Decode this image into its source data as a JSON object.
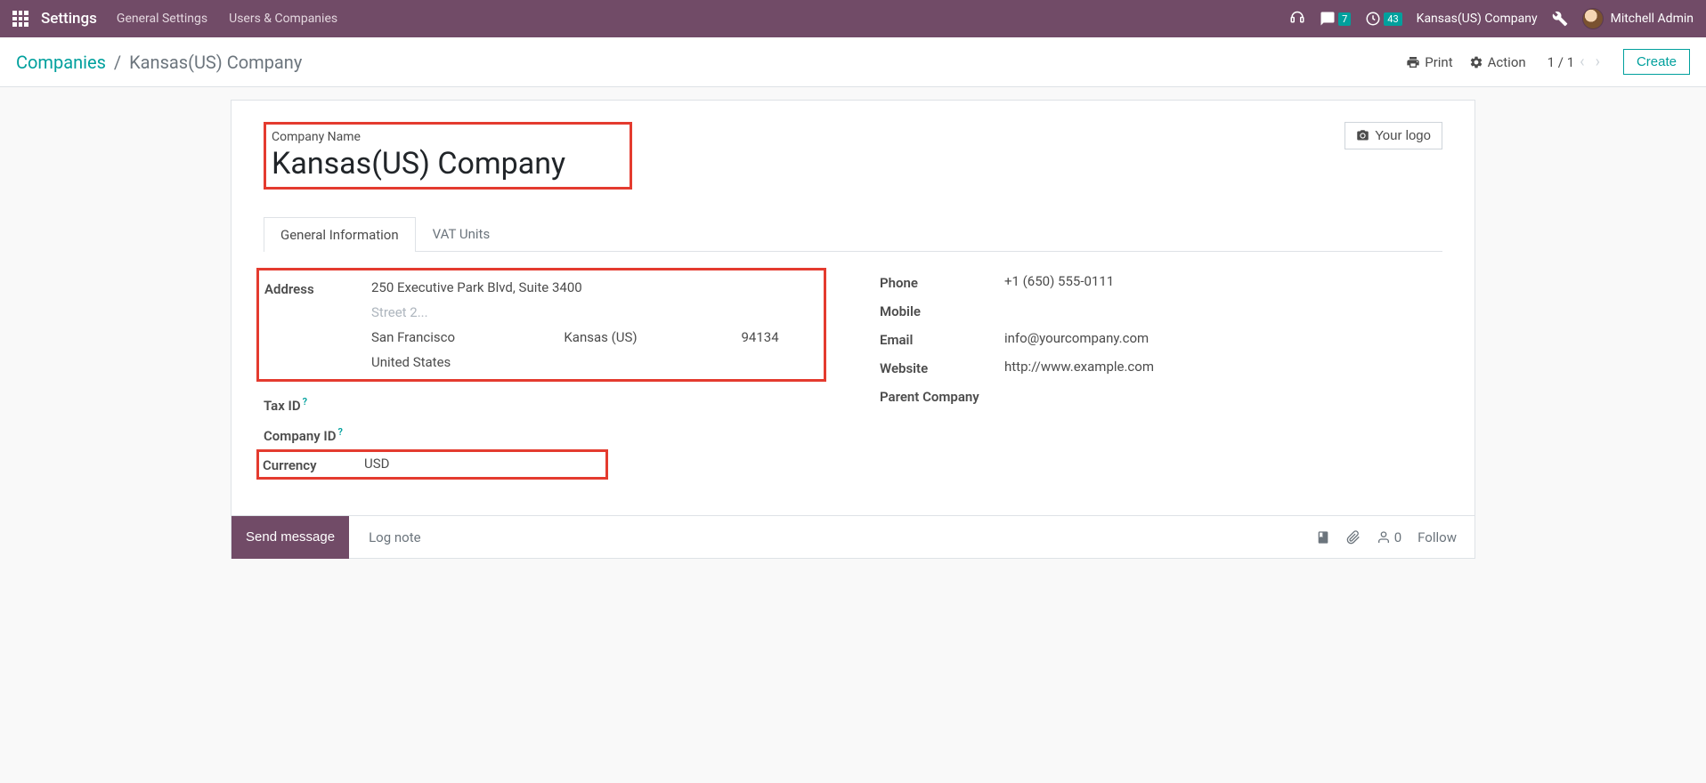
{
  "topnav": {
    "brand": "Settings",
    "menu": [
      "General Settings",
      "Users & Companies"
    ],
    "msg_badge": "7",
    "activity_badge": "43",
    "company": "Kansas(US) Company",
    "user": "Mitchell Admin"
  },
  "ctrlbar": {
    "bc_root": "Companies",
    "bc_current": "Kansas(US) Company",
    "print": "Print",
    "action": "Action",
    "pager": "1 / 1",
    "create": "Create"
  },
  "sheet": {
    "logo_label": "Your logo",
    "name_label": "Company Name",
    "name_value": "Kansas(US) Company",
    "tabs": {
      "general": "General Information",
      "vat": "VAT Units"
    },
    "labels": {
      "address": "Address",
      "tax_id": "Tax ID",
      "company_id": "Company ID",
      "currency": "Currency",
      "phone": "Phone",
      "mobile": "Mobile",
      "email": "Email",
      "website": "Website",
      "parent": "Parent Company"
    },
    "address": {
      "street": "250 Executive Park Blvd, Suite 3400",
      "street2_ph": "Street 2...",
      "city": "San Francisco",
      "state": "Kansas (US)",
      "zip": "94134",
      "country": "United States"
    },
    "currency": "USD",
    "phone": "+1 (650) 555-0111",
    "email": "info@yourcompany.com",
    "website": "http://www.example.com"
  },
  "chatter": {
    "send": "Send message",
    "log": "Log note",
    "followers": "0",
    "follow": "Follow"
  }
}
